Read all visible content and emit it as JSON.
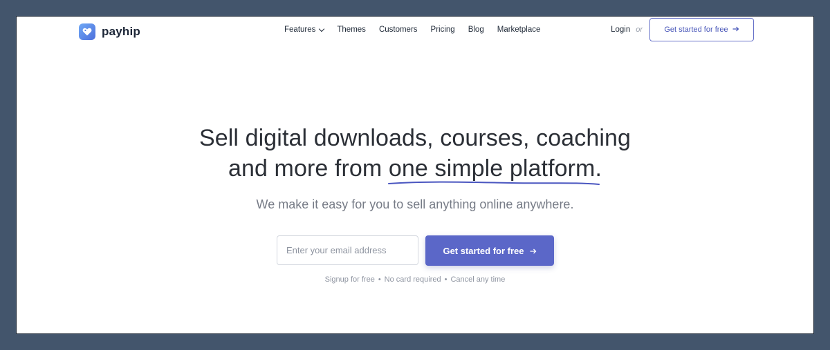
{
  "brand": {
    "name": "payhip",
    "accent": "#5b67c8"
  },
  "nav": {
    "features": "Features",
    "themes": "Themes",
    "customers": "Customers",
    "pricing": "Pricing",
    "blog": "Blog",
    "marketplace": "Marketplace"
  },
  "header_actions": {
    "login": "Login",
    "or": "or",
    "cta": "Get started for free",
    "cta_icon": "arrow-right-icon"
  },
  "hero": {
    "title_line1": "Sell digital downloads, courses, coaching",
    "title_line2_prefix": "and more from ",
    "title_highlight": "one simple platform",
    "title_line2_suffix": ".",
    "subtitle": "We make it easy for you to sell anything online anywhere."
  },
  "signup": {
    "email_placeholder": "Enter your email address",
    "email_value": "",
    "cta": "Get started for free",
    "cta_icon": "arrow-right-icon"
  },
  "notes": {
    "item1": "Signup for free",
    "item2": "No card required",
    "item3": "Cancel any time",
    "separator": "•"
  }
}
